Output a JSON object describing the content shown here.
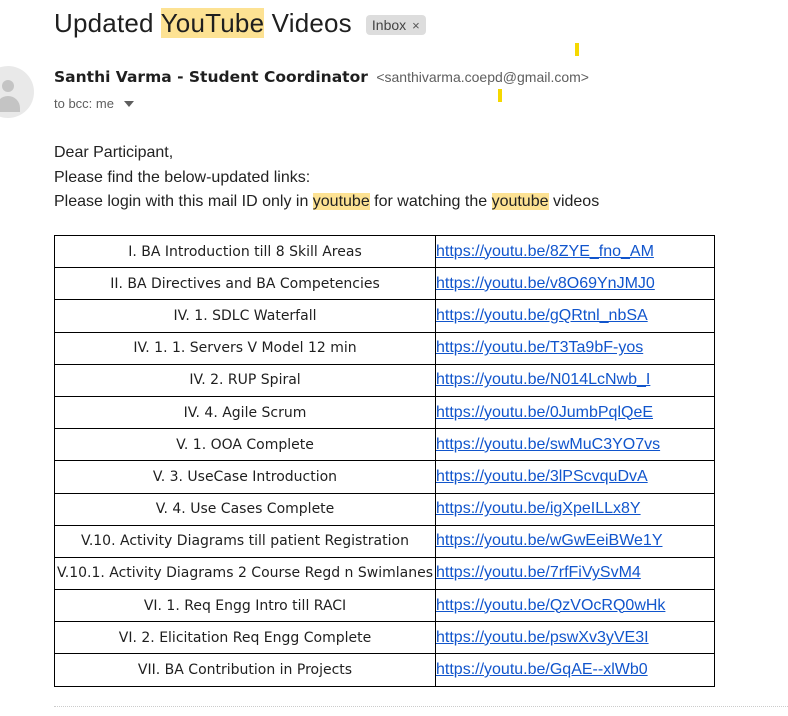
{
  "email": {
    "subject_before": "Updated ",
    "subject_highlight": "YouTube",
    "subject_after": " Videos",
    "label": "Inbox",
    "label_close": "×",
    "sender_name": "Santhi Varma - Student Coordinator",
    "sender_email": "<santhivarma.coepd@gmail.com>",
    "recipients": "to bcc: me",
    "greeting": "Dear Participant,",
    "line1": "Please find the below-updated links:",
    "line2_part1": "Please login with this mail ID only in ",
    "line2_hl1": "youtube",
    "line2_part2": " for watching the ",
    "line2_hl2": "youtube",
    "line2_part3": " videos"
  },
  "links_table": [
    {
      "topic": "I. BA Introduction till 8 Skill Areas",
      "url": "https://youtu.be/8ZYE_fno_AM"
    },
    {
      "topic": "II. BA Directives and BA Competencies",
      "url": "https://youtu.be/v8O69YnJMJ0"
    },
    {
      "topic": "IV. 1. SDLC Waterfall",
      "url": "https://youtu.be/gQRtnl_nbSA"
    },
    {
      "topic": "IV. 1. 1. Servers V Model 12 min",
      "url": "https://youtu.be/T3Ta9bF-yos"
    },
    {
      "topic": "IV. 2. RUP Spiral",
      "url": "https://youtu.be/N014LcNwb_I"
    },
    {
      "topic": "IV. 4. Agile Scrum",
      "url": "https://youtu.be/0JumbPqlQeE"
    },
    {
      "topic": "V. 1. OOA Complete",
      "url": "https://youtu.be/swMuC3YO7vs"
    },
    {
      "topic": "V. 3. UseCase Introduction",
      "url": "https://youtu.be/3lPScvquDvA"
    },
    {
      "topic": "V. 4. Use Cases Complete",
      "url": "https://youtu.be/igXpeILLx8Y"
    },
    {
      "topic": "V.10. Activity Diagrams till patient Registration",
      "url": "https://youtu.be/wGwEeiBWe1Y"
    },
    {
      "topic": "V.10.1. Activity Diagrams 2 Course Regd n Swimlanes",
      "url": "https://youtu.be/7rfFiVySvM4"
    },
    {
      "topic": "VI. 1. Req Engg Intro till RACI",
      "url": "https://youtu.be/QzVOcRQ0wHk"
    },
    {
      "topic": "VI. 2. Elicitation Req Engg Complete",
      "url": "https://youtu.be/pswXv3yVE3I"
    },
    {
      "topic": "VII. BA Contribution in Projects",
      "url": "https://youtu.be/GqAE--xlWb0"
    }
  ],
  "colors": {
    "highlight": "#fde293",
    "link": "#1155cc",
    "marker": "#f5d800"
  },
  "icons": {
    "avatar": "person-avatar-icon",
    "caret": "chevron-down-icon",
    "close": "close-icon"
  }
}
